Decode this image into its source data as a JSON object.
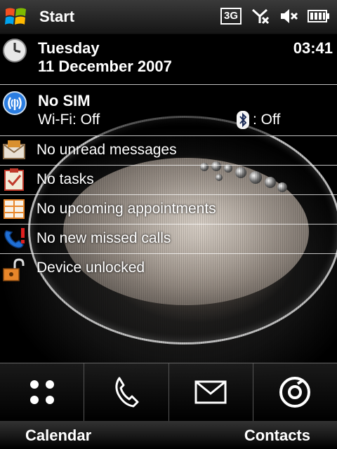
{
  "taskbar": {
    "start_label": "Start",
    "network_badge": "3G",
    "icons": [
      "windows-logo-icon",
      "network-3g-icon",
      "no-signal-icon",
      "volume-muted-icon",
      "battery-icon"
    ]
  },
  "today": {
    "day": "Tuesday",
    "date": "11 December 2007",
    "time": "03:41",
    "sim_status": "No SIM",
    "wifi_status": "Wi-Fi: Off",
    "bluetooth_status": ": Off",
    "items": [
      {
        "icon": "messages-icon",
        "label": "No unread messages"
      },
      {
        "icon": "tasks-icon",
        "label": "No tasks"
      },
      {
        "icon": "calendar-icon",
        "label": "No upcoming appointments"
      },
      {
        "icon": "missed-calls-icon",
        "label": "No new missed calls"
      },
      {
        "icon": "unlock-icon",
        "label": "Device unlocked"
      }
    ]
  },
  "launcher": {
    "buttons": [
      "apps-grid-icon",
      "phone-icon",
      "envelope-icon",
      "media-player-icon"
    ]
  },
  "softkeys": {
    "left": "Calendar",
    "right": "Contacts"
  },
  "colors": {
    "accent_orange": "#e8862a",
    "accent_blue": "#2a7de1",
    "row_line": "#ffffff"
  }
}
